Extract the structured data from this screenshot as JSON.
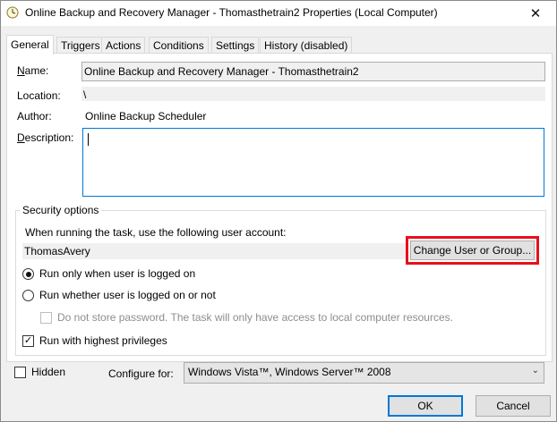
{
  "window": {
    "title": "Online Backup and Recovery Manager - Thomasthetrain2 Properties (Local Computer)",
    "icon": "clock-icon",
    "close_glyph": "✕"
  },
  "tabs": [
    {
      "label": "General",
      "active": true
    },
    {
      "label": "Triggers"
    },
    {
      "label": "Actions"
    },
    {
      "label": "Conditions"
    },
    {
      "label": "Settings"
    },
    {
      "label": "History (disabled)"
    }
  ],
  "general": {
    "name_label": "Name:",
    "name_value": "Online Backup and Recovery Manager - Thomasthetrain2",
    "location_label": "Location:",
    "location_value": "\\",
    "author_label": "Author:",
    "author_value": "Online Backup Scheduler",
    "description_label": "Description:",
    "description_value": ""
  },
  "security": {
    "group_title": "Security options",
    "account_prompt": "When running the task, use the following user account:",
    "account_value": "ThomasAvery",
    "change_button": "Change User or Group...",
    "radio_logged_on": "Run only when user is logged on",
    "radio_logged_on_checked": true,
    "radio_whether": "Run whether user is logged on or not",
    "radio_whether_checked": false,
    "no_store_password": "Do not store password.  The task will only have access to local computer resources.",
    "highest_privileges": "Run with highest privileges",
    "highest_privileges_checked": true,
    "highlight_color": "#e8101c"
  },
  "bottom": {
    "hidden_label": "Hidden",
    "configure_label": "Configure for:",
    "configure_value": "Windows Vista™, Windows Server™ 2008"
  },
  "footer": {
    "ok": "OK",
    "cancel": "Cancel"
  }
}
